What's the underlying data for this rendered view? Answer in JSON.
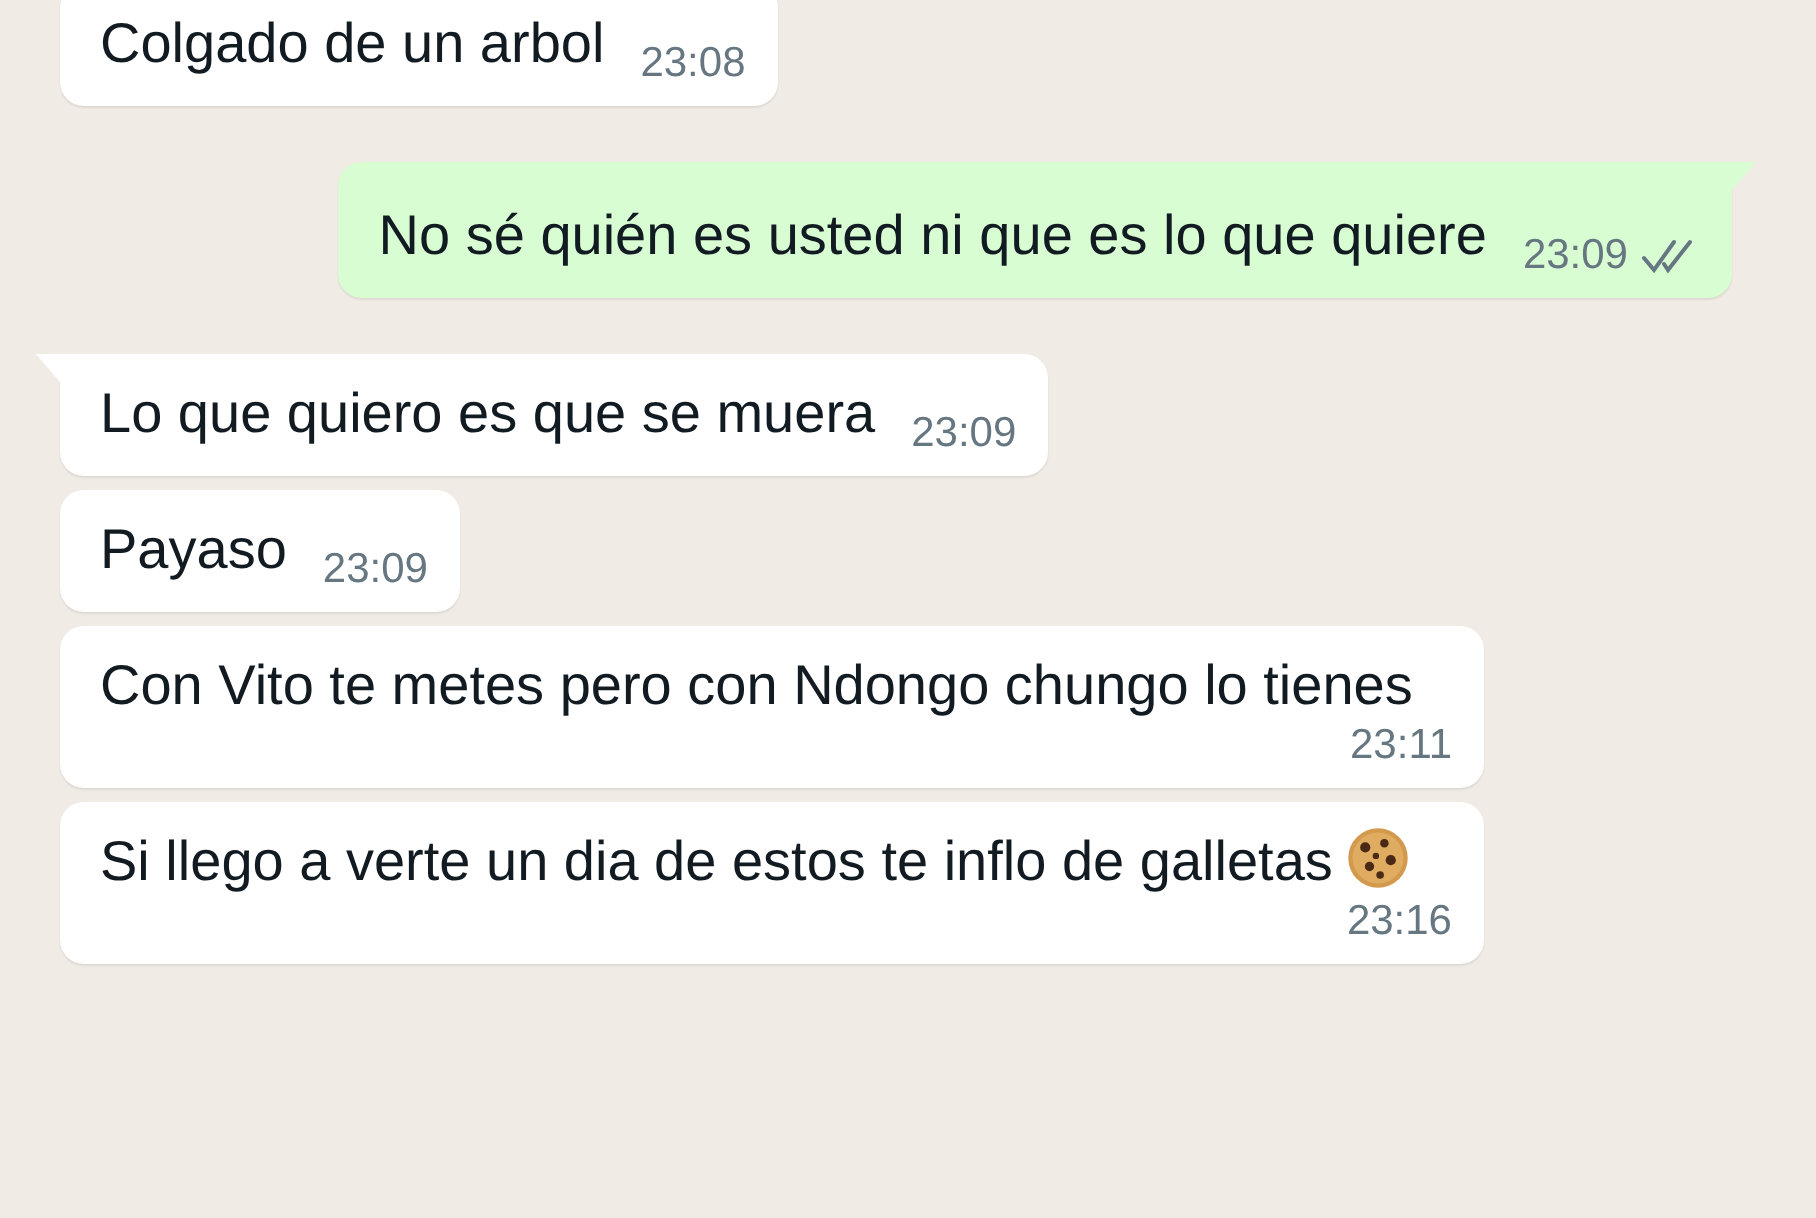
{
  "messages": [
    {
      "kind": "incoming",
      "tail": false,
      "text": "Colgado de un arbol",
      "time": "23:08"
    },
    {
      "kind": "outgoing",
      "tail": true,
      "text": "No sé quién es usted ni que es lo que quiere",
      "time": "23:09",
      "read": false
    },
    {
      "kind": "incoming",
      "tail": true,
      "text": "Lo que quiero es que se muera",
      "time": "23:09"
    },
    {
      "kind": "incoming",
      "tail": false,
      "text": "Payaso",
      "time": "23:09"
    },
    {
      "kind": "incoming",
      "tail": false,
      "text": "Con Vito te metes pero con Ndongo chungo lo tienes",
      "time": "23:11"
    },
    {
      "kind": "incoming",
      "tail": false,
      "text": "Si llego a verte un dia de estos te inflo de galletas",
      "time": "23:16",
      "cookie": true
    }
  ]
}
